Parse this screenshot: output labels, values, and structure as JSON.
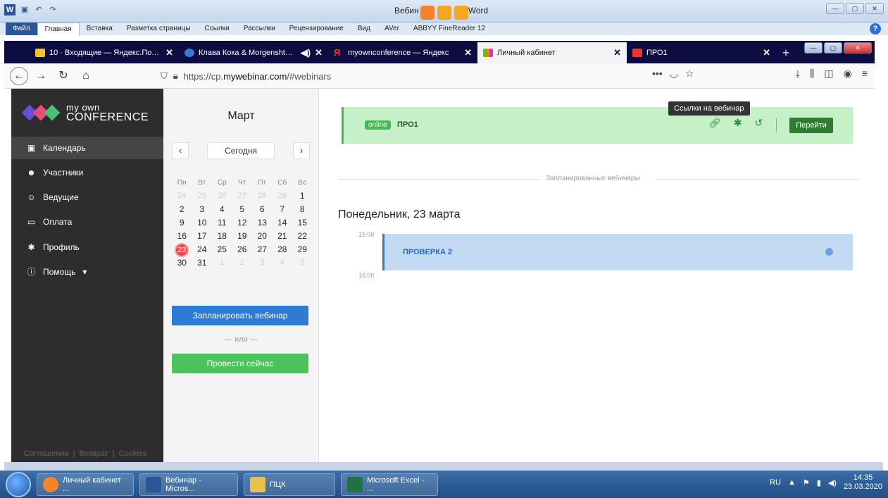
{
  "word": {
    "title_left": "Вебин",
    "title_right": "Word",
    "file_label": "Файл",
    "menu": [
      "Главная",
      "Вставка",
      "Разметка страницы",
      "Ссылки",
      "Рассылки",
      "Рецензирование",
      "Вид",
      "AVer",
      "ABBYY FineReader 12"
    ],
    "help_label": "?"
  },
  "browser": {
    "tabs": [
      {
        "label": "10 · Входящие — Яндекс.Почта",
        "color": "#f2c230"
      },
      {
        "label": "Клава Кока & Morgenshtern",
        "color": "#3a7bd5"
      },
      {
        "label": "myownconference — Яндекс",
        "color": "#e33"
      },
      {
        "label": "Личный кабинет",
        "color": "#6b2"
      },
      {
        "label": "ПРО1",
        "color": "#e33"
      }
    ],
    "url_prefix": "https://cp.",
    "url_domain": "mywebinar.com",
    "url_suffix": "/#webinars",
    "more_icon": "•••"
  },
  "sidebar": {
    "logo_line1": "my own",
    "logo_line2": "CONFERENCE",
    "items": [
      {
        "label": "Календарь",
        "icon": "calendar-icon"
      },
      {
        "label": "Участники",
        "icon": "users-icon"
      },
      {
        "label": "Ведущие",
        "icon": "presenter-icon"
      },
      {
        "label": "Оплата",
        "icon": "card-icon"
      },
      {
        "label": "Профиль",
        "icon": "gear-icon"
      },
      {
        "label": "Помощь",
        "icon": "info-icon"
      }
    ],
    "footer": [
      "Соглашение",
      "Возврат",
      "Cookies"
    ]
  },
  "calendar": {
    "month": "Март",
    "today_label": "Сегодня",
    "prev": "‹",
    "next": "›",
    "weekdays": [
      "Пн",
      "Вт",
      "Ср",
      "Чт",
      "Пт",
      "Сб",
      "Вс"
    ],
    "weeks": [
      [
        "24",
        "25",
        "26",
        "27",
        "28",
        "29",
        "1"
      ],
      [
        "2",
        "3",
        "4",
        "5",
        "6",
        "7",
        "8"
      ],
      [
        "9",
        "10",
        "11",
        "12",
        "13",
        "14",
        "15"
      ],
      [
        "16",
        "17",
        "18",
        "19",
        "20",
        "21",
        "22"
      ],
      [
        "23",
        "24",
        "25",
        "26",
        "27",
        "28",
        "29"
      ],
      [
        "30",
        "31",
        "1",
        "2",
        "3",
        "4",
        "5"
      ]
    ],
    "selected_day": "23",
    "plan_button": "Запланировать вебинар",
    "or_label": "— или —",
    "now_button": "Провести сейчас"
  },
  "main": {
    "online_badge": "online",
    "online_title": "ПРО1",
    "tooltip": "Ссылки на вебинар",
    "go_button": "Перейти",
    "scheduled_label": "Запланированные вебинары",
    "day_heading": "Понедельник, 23 марта",
    "time_start": "15:00",
    "time_end": "16:00",
    "event_title": "ПРОВЕРКА 2"
  },
  "taskbar": {
    "items": [
      {
        "label": "Личный кабинет ...",
        "color": "#f7822d"
      },
      {
        "label": "Вебинар - Micros...",
        "color": "#2b5797"
      },
      {
        "label": "ПЦК",
        "color": "#e8c04a"
      },
      {
        "label": "Microsoft Excel - ...",
        "color": "#207245"
      }
    ],
    "lang": "RU",
    "time": "14:35",
    "date": "23.03.2020"
  }
}
